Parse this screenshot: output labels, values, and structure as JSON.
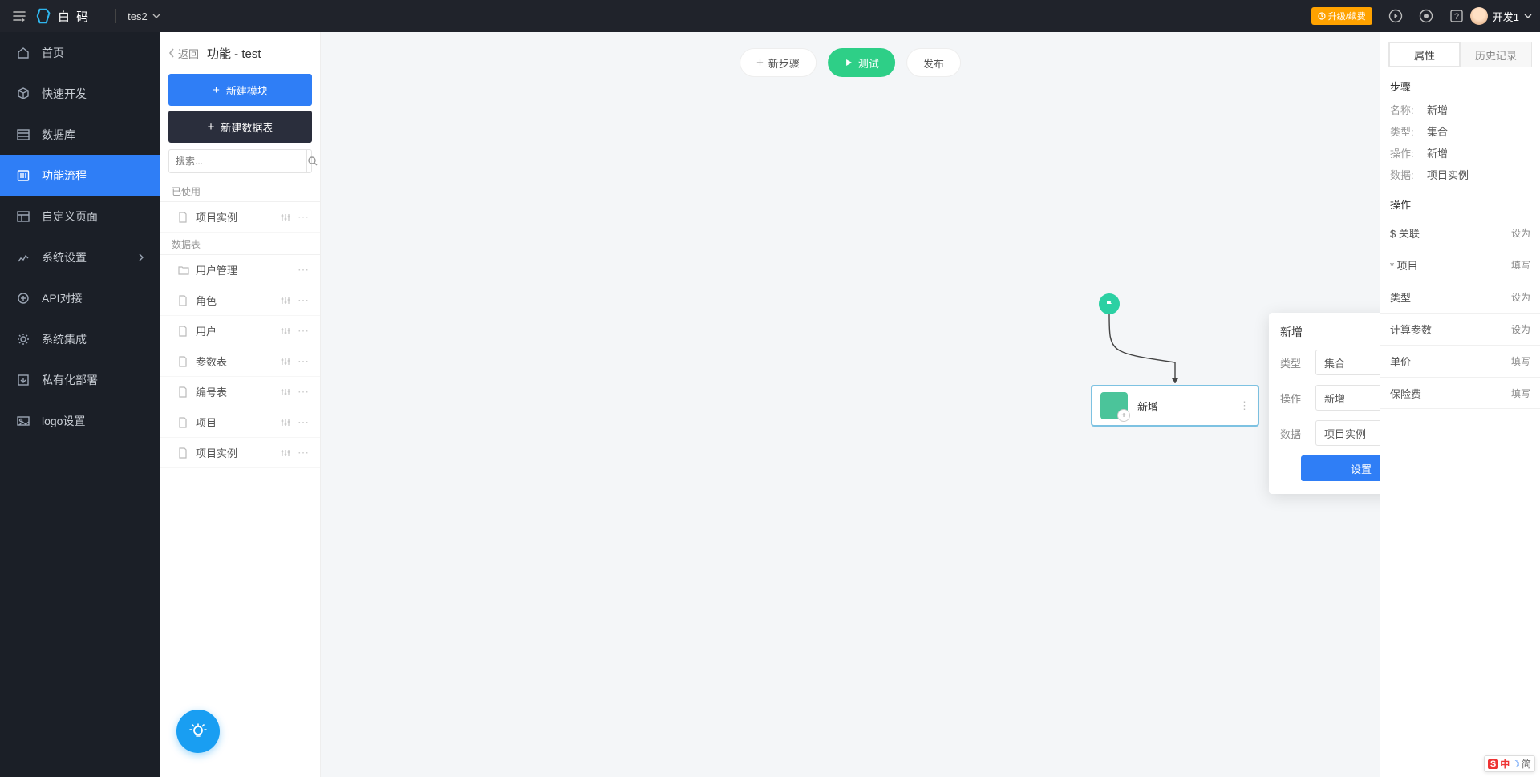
{
  "topbar": {
    "logo_text": "白 码",
    "project": "tes2",
    "upgrade": "升级/续费",
    "user": "开发1"
  },
  "nav": {
    "items": [
      {
        "label": "首页"
      },
      {
        "label": "快速开发"
      },
      {
        "label": "数据库"
      },
      {
        "label": "功能流程"
      },
      {
        "label": "自定义页面"
      },
      {
        "label": "系统设置",
        "expand": true
      },
      {
        "label": "API对接"
      },
      {
        "label": "系统集成"
      },
      {
        "label": "私有化部署"
      },
      {
        "label": "logo设置"
      }
    ]
  },
  "leftpanel": {
    "back": "返回",
    "title": "功能 - test",
    "new_module": "新建模块",
    "new_table": "新建数据表",
    "search_placeholder": "搜索...",
    "groups": {
      "used": {
        "label": "已使用",
        "items": [
          {
            "label": "项目实例",
            "sliders": true
          }
        ]
      },
      "tables": {
        "label": "数据表",
        "items": [
          {
            "label": "用户管理",
            "folder": true
          },
          {
            "label": "角色",
            "sliders": true
          },
          {
            "label": "用户",
            "sliders": true
          },
          {
            "label": "参数表",
            "sliders": true
          },
          {
            "label": "编号表",
            "sliders": true
          },
          {
            "label": "项目",
            "sliders": true
          },
          {
            "label": "项目实例",
            "sliders": true
          }
        ]
      }
    }
  },
  "canvas": {
    "btn_new_step": "新步骤",
    "btn_test": "测试",
    "btn_publish": "发布",
    "step_label": "新增",
    "popup": {
      "title": "新增",
      "rows": [
        {
          "label": "类型",
          "value": "集合"
        },
        {
          "label": "操作",
          "value": "新增"
        },
        {
          "label": "数据",
          "value": "项目实例"
        }
      ],
      "btn": "设置"
    }
  },
  "rightpanel": {
    "tabs": {
      "attr": "属性",
      "history": "历史记录"
    },
    "step_title": "步骤",
    "kv": [
      {
        "k": "名称:",
        "v": "新增"
      },
      {
        "k": "类型:",
        "v": "集合"
      },
      {
        "k": "操作:",
        "v": "新增"
      },
      {
        "k": "数据:",
        "v": "项目实例"
      }
    ],
    "op_title": "操作",
    "ops": [
      {
        "label": "$ 关联",
        "act": "设为"
      },
      {
        "label": "* 项目",
        "act": "填写"
      },
      {
        "label": "类型",
        "act": "设为"
      },
      {
        "label": "计算参数",
        "act": "设为"
      },
      {
        "label": "单价",
        "act": "填写"
      },
      {
        "label": "保险费",
        "act": "填写"
      }
    ]
  },
  "ime": {
    "s": "S",
    "zh": "中",
    "jian": "简"
  }
}
